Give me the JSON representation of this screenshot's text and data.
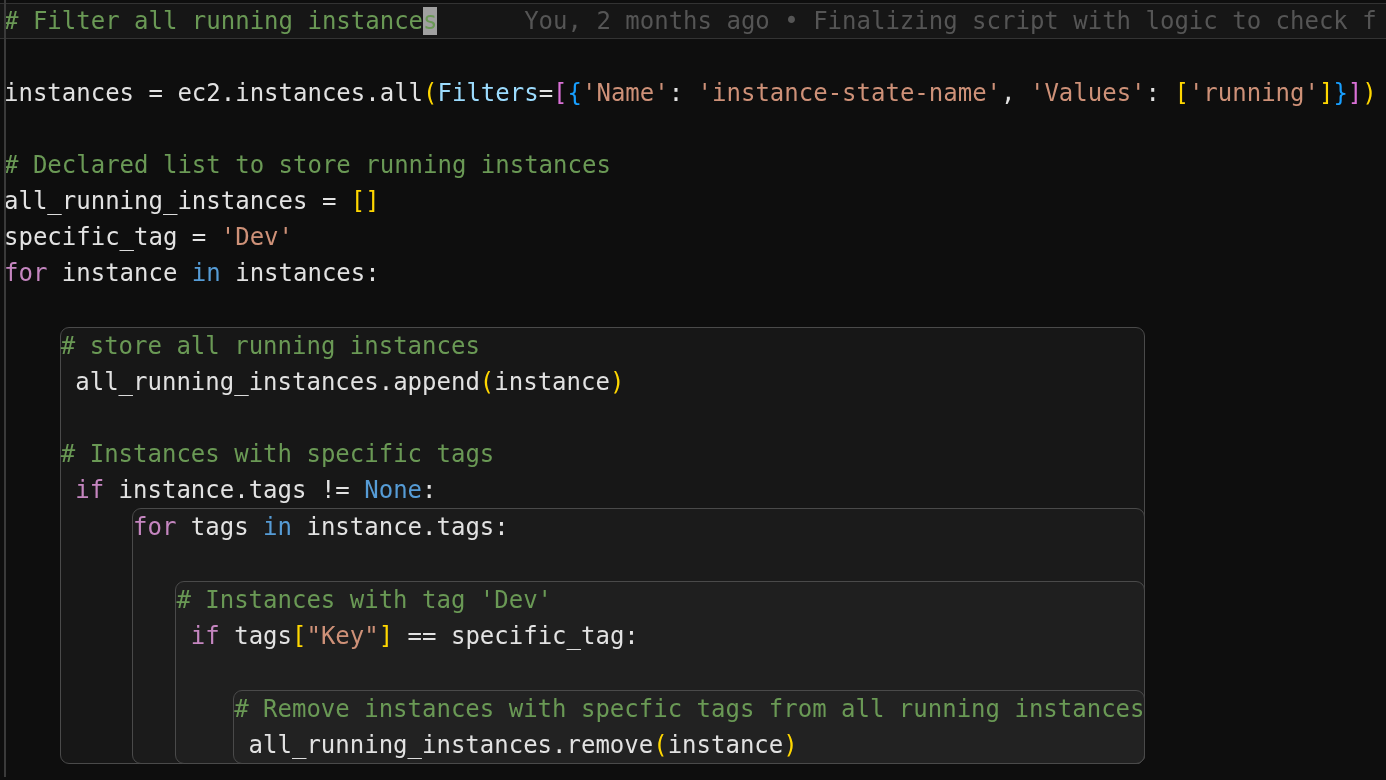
{
  "editor": {
    "lines": [
      {
        "kind": "current",
        "tokens": [
          {
            "text": "# Filter all running instance",
            "kind": "comment"
          }
        ],
        "cursor": "s",
        "blame": "You, 2 months ago • Finalizing script with logic to check f"
      },
      {
        "kind": "blank"
      },
      {
        "kind": "code",
        "tokens": [
          {
            "text": "instances = ec2.instances.all",
            "kind": "plain"
          },
          {
            "text": "(",
            "kind": "bracket1"
          },
          {
            "text": "Filters",
            "kind": "param"
          },
          {
            "text": "=",
            "kind": "plain"
          },
          {
            "text": "[",
            "kind": "bracket2"
          },
          {
            "text": "{",
            "kind": "bracket3"
          },
          {
            "text": "'Name'",
            "kind": "string"
          },
          {
            "text": ": ",
            "kind": "plain"
          },
          {
            "text": "'instance-state-name'",
            "kind": "string"
          },
          {
            "text": ", ",
            "kind": "plain"
          },
          {
            "text": "'Values'",
            "kind": "string"
          },
          {
            "text": ": ",
            "kind": "plain"
          },
          {
            "text": "[",
            "kind": "bracket1"
          },
          {
            "text": "'running'",
            "kind": "string"
          },
          {
            "text": "]",
            "kind": "bracket1"
          },
          {
            "text": "}",
            "kind": "bracket3"
          },
          {
            "text": "]",
            "kind": "bracket2"
          },
          {
            "text": ")",
            "kind": "bracket1"
          }
        ]
      },
      {
        "kind": "blank"
      },
      {
        "kind": "code",
        "tokens": [
          {
            "text": "# Declared list to store running instances",
            "kind": "comment"
          }
        ]
      },
      {
        "kind": "code",
        "tokens": [
          {
            "text": "all_running_instances = ",
            "kind": "plain"
          },
          {
            "text": "[]",
            "kind": "bracket1"
          }
        ]
      },
      {
        "kind": "code",
        "tokens": [
          {
            "text": "specific_tag = ",
            "kind": "plain"
          },
          {
            "text": "'Dev'",
            "kind": "string"
          }
        ]
      },
      {
        "kind": "code",
        "tokens": [
          {
            "text": "for",
            "kind": "keyword"
          },
          {
            "text": " instance ",
            "kind": "plain"
          },
          {
            "text": "in",
            "kind": "builtin"
          },
          {
            "text": " instances:",
            "kind": "plain"
          }
        ]
      },
      {
        "kind": "blank"
      },
      {
        "kind": "block",
        "children": [
          {
            "kind": "code",
            "tokens": [
              {
                "text": "# store all running instances",
                "kind": "comment"
              }
            ]
          },
          {
            "kind": "code",
            "tokens": [
              {
                "text": " all_running_instances.append",
                "kind": "plain"
              },
              {
                "text": "(",
                "kind": "bracket1"
              },
              {
                "text": "instance",
                "kind": "plain"
              },
              {
                "text": ")",
                "kind": "bracket1"
              }
            ]
          },
          {
            "kind": "blank"
          },
          {
            "kind": "code",
            "tokens": [
              {
                "text": "# Instances with specific tags",
                "kind": "comment"
              }
            ]
          },
          {
            "kind": "code",
            "tokens": [
              {
                "text": " if",
                "kind": "keyword"
              },
              {
                "text": " instance.tags != ",
                "kind": "plain"
              },
              {
                "text": "None",
                "kind": "builtin"
              },
              {
                "text": ":",
                "kind": "plain"
              }
            ]
          },
          {
            "kind": "block",
            "children": [
              {
                "kind": "code",
                "tokens": [
                  {
                    "text": "for",
                    "kind": "keyword"
                  },
                  {
                    "text": " tags ",
                    "kind": "plain"
                  },
                  {
                    "text": "in",
                    "kind": "builtin"
                  },
                  {
                    "text": " instance.tags:",
                    "kind": "plain"
                  }
                ]
              },
              {
                "kind": "blank"
              },
              {
                "kind": "block",
                "children": [
                  {
                    "kind": "code",
                    "tokens": [
                      {
                        "text": "# Instances with tag 'Dev'",
                        "kind": "comment"
                      }
                    ]
                  },
                  {
                    "kind": "code",
                    "tokens": [
                      {
                        "text": " if",
                        "kind": "keyword"
                      },
                      {
                        "text": " tags",
                        "kind": "plain"
                      },
                      {
                        "text": "[",
                        "kind": "bracket1"
                      },
                      {
                        "text": "\"Key\"",
                        "kind": "string"
                      },
                      {
                        "text": "]",
                        "kind": "bracket1"
                      },
                      {
                        "text": " == specific_tag:",
                        "kind": "plain"
                      }
                    ]
                  },
                  {
                    "kind": "blank"
                  },
                  {
                    "kind": "block",
                    "children": [
                      {
                        "kind": "code",
                        "tokens": [
                          {
                            "text": "# Remove instances with specfic tags from all running instances",
                            "kind": "comment"
                          }
                        ]
                      },
                      {
                        "kind": "code",
                        "tokens": [
                          {
                            "text": " all_running_instances.remove",
                            "kind": "plain"
                          },
                          {
                            "text": "(",
                            "kind": "bracket1"
                          },
                          {
                            "text": "instance",
                            "kind": "plain"
                          },
                          {
                            "text": ")",
                            "kind": "bracket1"
                          }
                        ]
                      }
                    ]
                  }
                ]
              }
            ]
          }
        ]
      }
    ]
  }
}
